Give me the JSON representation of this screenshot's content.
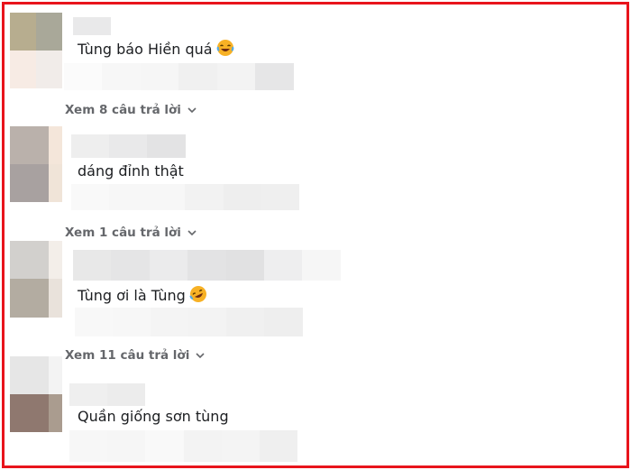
{
  "comments": [
    {
      "text": "Tùng báo Hiền quá",
      "emoji": "laughing-tears-emoji",
      "replies": "Xem 8 câu trả lời"
    },
    {
      "text": "dáng đỉnh thật",
      "replies": "Xem 1 câu trả lời"
    },
    {
      "text": "Tùng ơi là Tùng",
      "emoji": "rofl-emoji",
      "replies": "Xem 11 câu trả lời"
    },
    {
      "text": "Quần giống sơn tùng"
    }
  ],
  "colors": {
    "frame": "#e8141c",
    "reply_link": "#65676b",
    "comment_text": "#1c1e21",
    "emoji_face": "#f7b125"
  }
}
